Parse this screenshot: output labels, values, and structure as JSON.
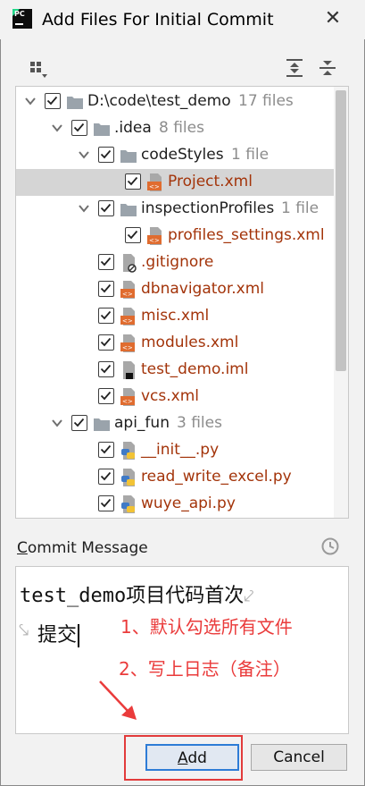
{
  "window": {
    "title": "Add Files For Initial Commit",
    "app_icon_text": "PC"
  },
  "tree": [
    {
      "indent": 0,
      "kind": "dir",
      "expanded": true,
      "checked": true,
      "name": "D:\\code\\test_demo",
      "count": "17 files"
    },
    {
      "indent": 1,
      "kind": "dir",
      "expanded": true,
      "checked": true,
      "name": ".idea",
      "count": "8 files"
    },
    {
      "indent": 2,
      "kind": "dir",
      "expanded": true,
      "checked": true,
      "name": "codeStyles",
      "count": "1 file"
    },
    {
      "indent": 3,
      "kind": "xml",
      "checked": true,
      "selected": true,
      "name": "Project.xml"
    },
    {
      "indent": 2,
      "kind": "dir",
      "expanded": true,
      "checked": true,
      "name": "inspectionProfiles",
      "count": "1 file"
    },
    {
      "indent": 3,
      "kind": "xml",
      "checked": true,
      "name": "profiles_settings.xml"
    },
    {
      "indent": 2,
      "kind": "ignore",
      "checked": true,
      "name": ".gitignore"
    },
    {
      "indent": 2,
      "kind": "xml",
      "checked": true,
      "name": "dbnavigator.xml"
    },
    {
      "indent": 2,
      "kind": "xml",
      "checked": true,
      "name": "misc.xml"
    },
    {
      "indent": 2,
      "kind": "xml",
      "checked": true,
      "name": "modules.xml"
    },
    {
      "indent": 2,
      "kind": "iml",
      "checked": true,
      "name": "test_demo.iml"
    },
    {
      "indent": 2,
      "kind": "xml",
      "checked": true,
      "name": "vcs.xml"
    },
    {
      "indent": 1,
      "kind": "dir",
      "expanded": true,
      "checked": true,
      "name": "api_fun",
      "count": "3 files"
    },
    {
      "indent": 2,
      "kind": "py",
      "checked": true,
      "name": "__init__.py"
    },
    {
      "indent": 2,
      "kind": "py",
      "checked": true,
      "name": "read_write_excel.py"
    },
    {
      "indent": 2,
      "kind": "py",
      "checked": true,
      "name": "wuye_api.py"
    }
  ],
  "commit": {
    "label_mnemonic": "C",
    "label_rest": "ommit Message",
    "line1": "test_demo项目代码首次",
    "line2": "提交",
    "wrap_symbol": "⤦",
    "wrap_start_symbol": "⤥"
  },
  "annotations": {
    "note1": "1、默认勾选所有文件",
    "note2": "2、写上日志（备注）",
    "color": "#ea3b3b"
  },
  "buttons": {
    "add_mnemonic": "A",
    "add_rest": "dd",
    "cancel": "Cancel"
  },
  "colors": {
    "file_text": "#a3340a",
    "count_text": "#8c8c8c",
    "selection": "#d5d5d5",
    "focus": "#2e7cd6"
  }
}
